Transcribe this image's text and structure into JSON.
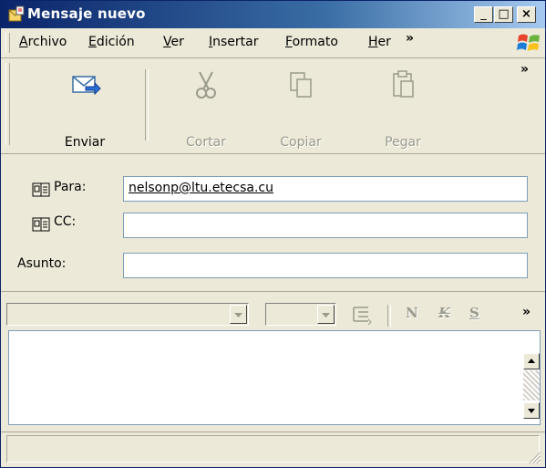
{
  "window": {
    "title": "Mensaje nuevo",
    "controls": [
      "_",
      "□",
      "×"
    ]
  },
  "menu": {
    "items": [
      {
        "pre": "",
        "key": "A",
        "post": "rchivo"
      },
      {
        "pre": "",
        "key": "E",
        "post": "dición"
      },
      {
        "pre": "",
        "key": "V",
        "post": "er"
      },
      {
        "pre": "",
        "key": "I",
        "post": "nsertar"
      },
      {
        "pre": "",
        "key": "F",
        "post": "ormato"
      },
      {
        "pre": "",
        "key": "H",
        "post": "er"
      }
    ],
    "overflow": "»"
  },
  "toolbar": {
    "send": "Enviar",
    "cut": "Cortar",
    "copy": "Copiar",
    "paste": "Pegar",
    "overflow": "»"
  },
  "header": {
    "to_label": "Para:",
    "to_value": "nelsonp@ltu.etecsa.cu",
    "cc_label": "CC:",
    "cc_value": "",
    "subject_label": "Asunto:",
    "subject_value": ""
  },
  "format": {
    "font_value": "",
    "size_value": "",
    "bold": "N",
    "italic": "K",
    "underline": "S",
    "overflow": "»"
  },
  "icons": [
    "message-icon",
    "send-icon",
    "scissors-icon",
    "copy-icon",
    "paste-icon",
    "address-book-icon",
    "windows-logo-icon",
    "list-icon"
  ]
}
